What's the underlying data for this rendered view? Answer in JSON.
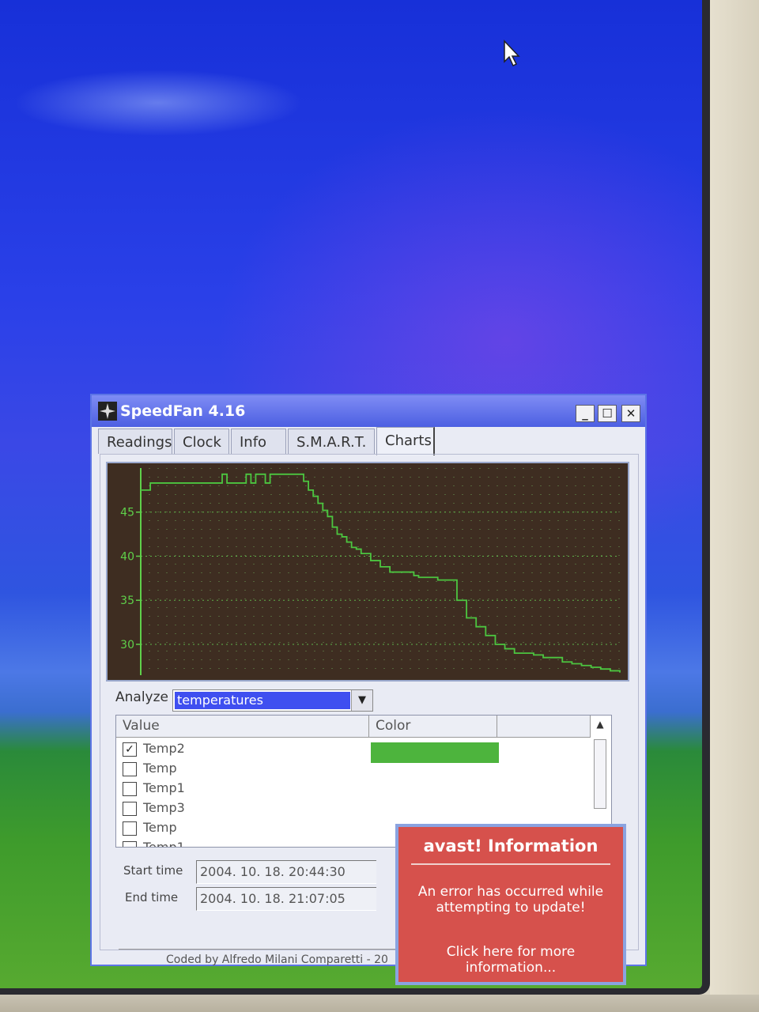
{
  "window": {
    "title": "SpeedFan 4.16",
    "minimize_glyph": "_",
    "maximize_glyph": "☐",
    "close_glyph": "✕"
  },
  "tabs": [
    {
      "label": "Readings",
      "active": false
    },
    {
      "label": "Clock",
      "active": false
    },
    {
      "label": "Info",
      "active": false
    },
    {
      "label": "S.M.A.R.T.",
      "active": false
    },
    {
      "label": "Charts",
      "active": true
    }
  ],
  "chart_data": {
    "type": "line",
    "ylim": [
      26.5,
      50
    ],
    "yticks": [
      "30",
      "35",
      "40",
      "45"
    ],
    "grid": true,
    "series": [
      {
        "color": "#4cc540",
        "x": [
          0,
          2,
          4,
          6,
          8,
          10,
          12,
          14,
          16,
          17,
          18,
          19,
          20,
          22,
          23,
          24,
          25,
          26,
          27,
          28,
          29,
          30,
          32,
          34,
          35,
          36,
          37,
          38,
          39,
          40,
          41,
          42,
          43,
          44,
          45,
          46,
          48,
          50,
          52,
          54,
          55,
          56,
          57,
          58,
          60,
          62,
          64,
          66,
          68,
          70,
          72,
          74,
          76,
          78,
          80,
          82,
          84,
          86,
          88,
          90,
          92,
          94,
          96,
          98,
          100
        ],
        "y": [
          47.5,
          48.3,
          48.3,
          48.3,
          48.3,
          48.3,
          48.3,
          48.3,
          48.3,
          49.3,
          48.3,
          48.3,
          48.3,
          49.3,
          48.3,
          49.3,
          49.3,
          48.3,
          49.3,
          49.3,
          49.3,
          49.3,
          49.3,
          48.5,
          47.5,
          46.8,
          46.0,
          45.2,
          44.5,
          43.3,
          42.5,
          42.2,
          41.6,
          41.0,
          40.8,
          40.3,
          39.5,
          38.8,
          38.2,
          38.2,
          38.2,
          38.2,
          37.8,
          37.6,
          37.6,
          37.3,
          37.3,
          35.0,
          33.0,
          32.0,
          31.0,
          30.0,
          29.5,
          29.0,
          29.0,
          28.8,
          28.5,
          28.5,
          28.0,
          27.8,
          27.6,
          27.4,
          27.2,
          27.0,
          26.8
        ]
      }
    ]
  },
  "analyze": {
    "label": "Analyze",
    "selected": "temperatures"
  },
  "sensor_list": {
    "columns": [
      "Value",
      "Color"
    ],
    "rows": [
      {
        "label": "Temp2",
        "checked": true,
        "color": "#4db43d"
      },
      {
        "label": "Temp",
        "checked": false
      },
      {
        "label": "Temp1",
        "checked": false
      },
      {
        "label": "Temp3",
        "checked": false
      },
      {
        "label": "Temp",
        "checked": false
      },
      {
        "label": "Temp1",
        "checked": false
      }
    ]
  },
  "time_range": {
    "start_label": "Start time",
    "start_value": "2004. 10. 18. 20:44:30",
    "end_label": "End time",
    "end_value": "2004. 10. 18. 21:07:05"
  },
  "credits": "Coded by Alfredo Milani Comparetti - 20",
  "avast": {
    "title": "avast! Information",
    "message": "An error has occurred while attempting to update!",
    "link": "Click here for more information..."
  }
}
